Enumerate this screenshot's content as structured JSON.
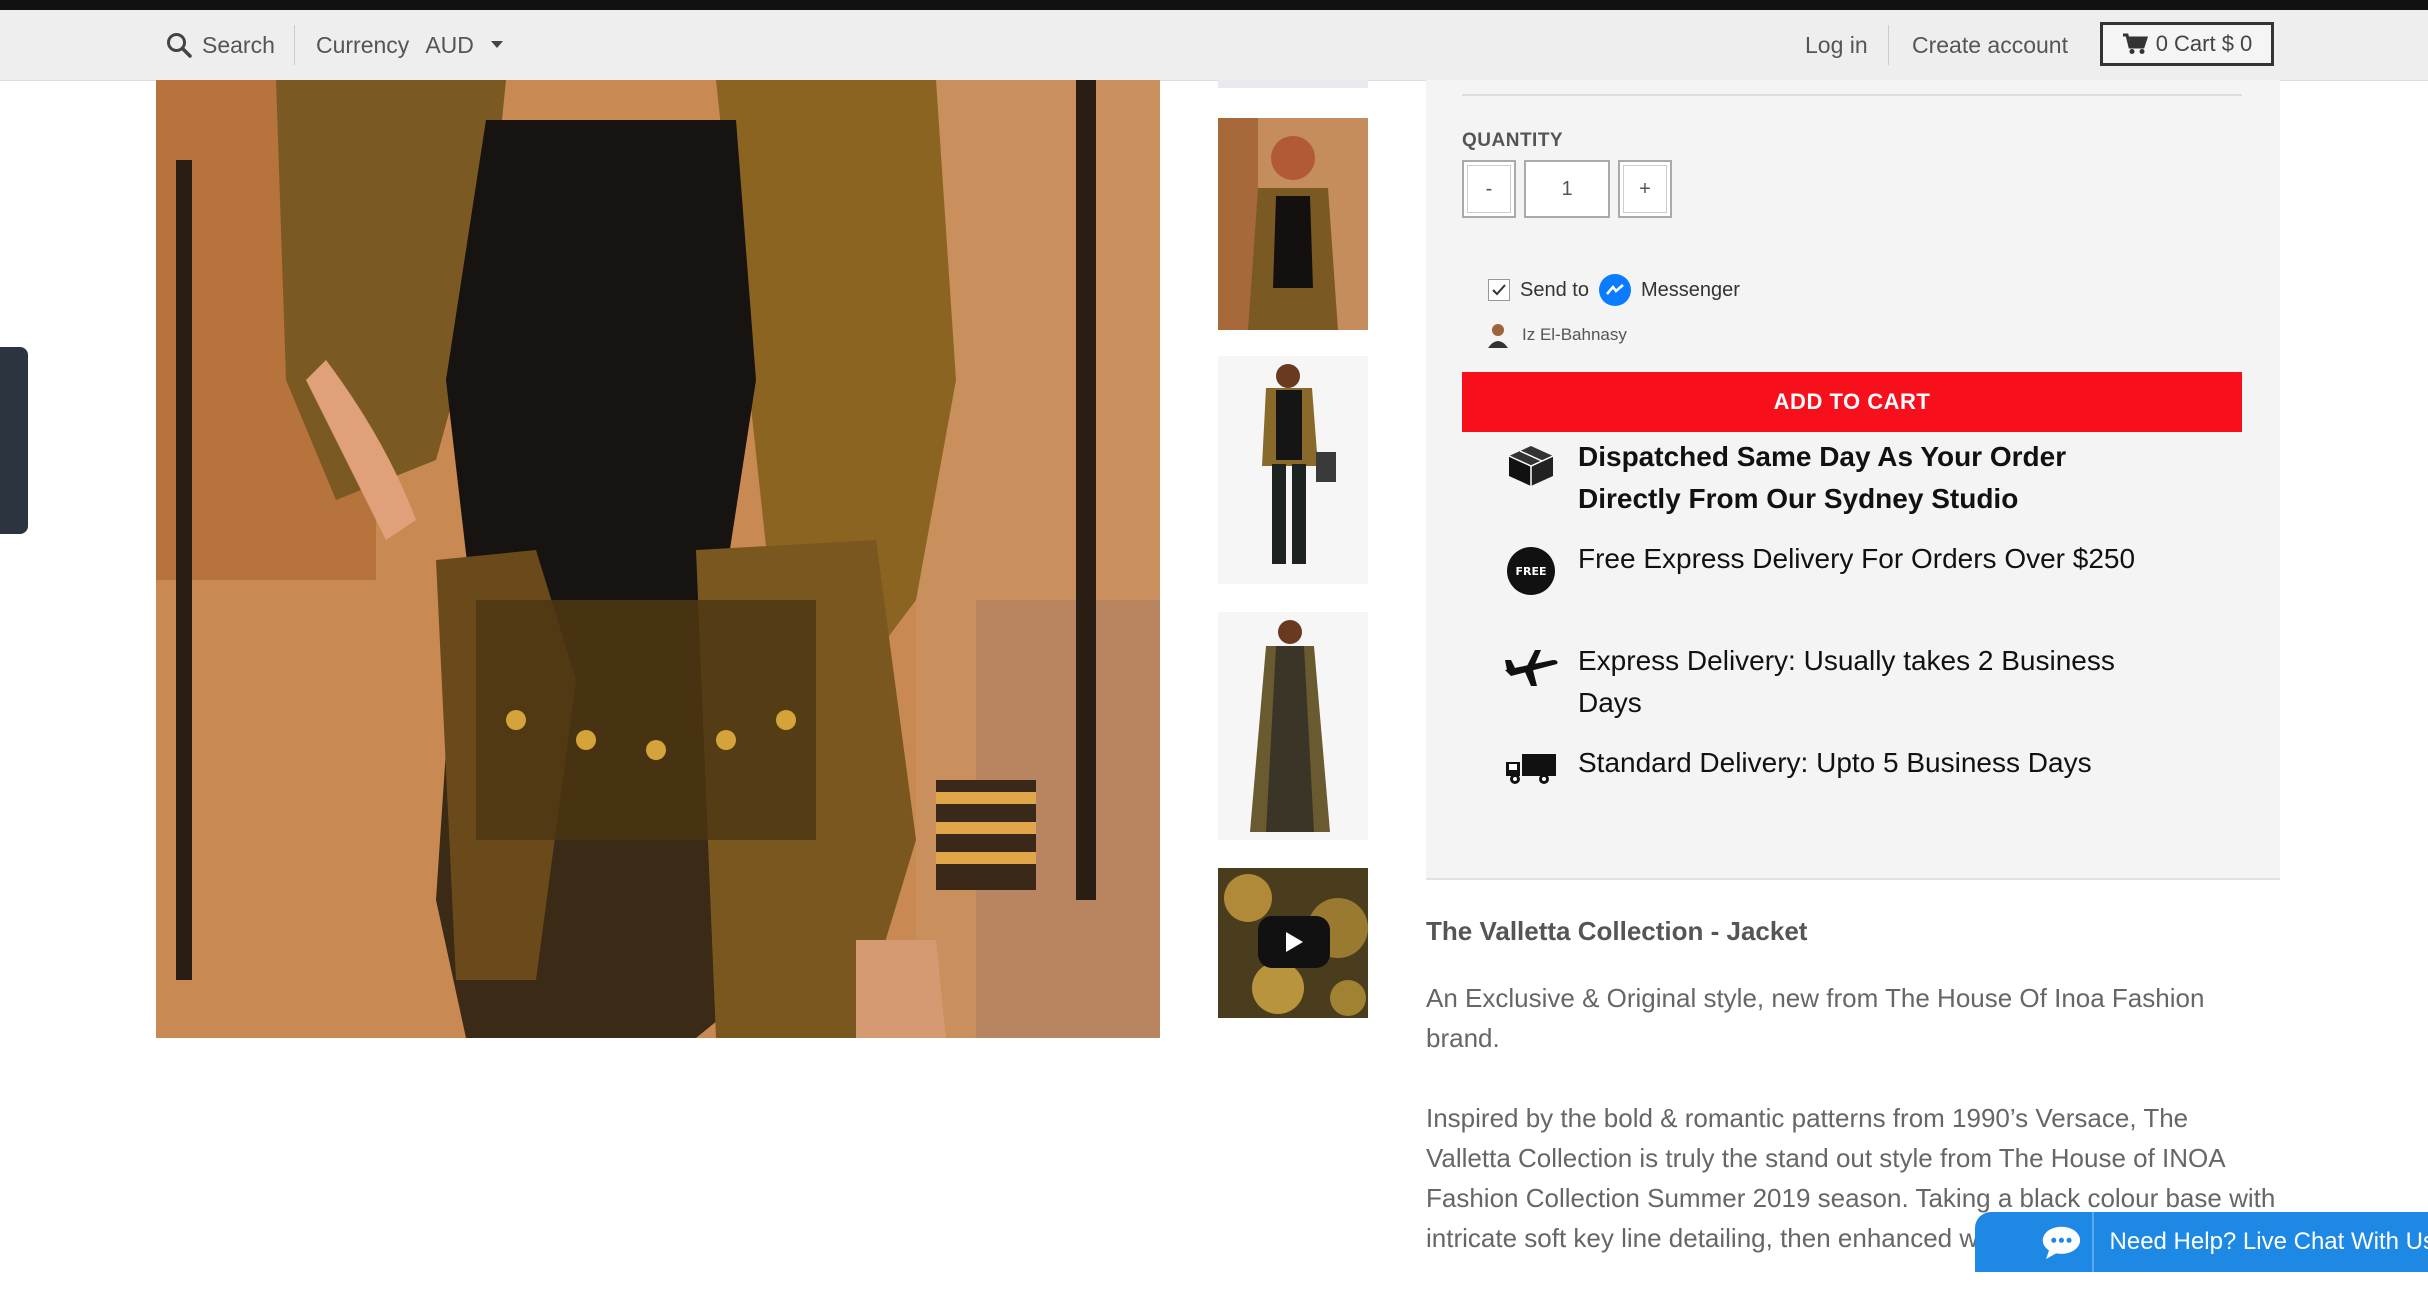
{
  "topbar": {
    "search_label": "Search",
    "currency_label": "Currency",
    "currency_value": "AUD",
    "login_label": "Log in",
    "create_account_label": "Create account",
    "cart_label": "0 Cart $ 0"
  },
  "purchase": {
    "quantity_label": "QUANTITY",
    "minus_label": "-",
    "quantity_value": "1",
    "plus_label": "+",
    "send_to_label": "Send to",
    "messenger_label": "Messenger",
    "user_name": "Iz El-Bahnasy",
    "add_to_cart_label": "ADD TO CART"
  },
  "features": [
    {
      "icon": "package-icon",
      "text": "Dispatched Same Day As Your Order Directly From Our Sydney Studio"
    },
    {
      "icon": "free-badge-icon",
      "badge": "FREE",
      "text": "Free Express Delivery For Orders Over $250"
    },
    {
      "icon": "airplane-icon",
      "text": "Express Delivery: Usually takes 2 Business Days"
    },
    {
      "icon": "truck-icon",
      "text": "Standard Delivery: Upto 5 Business Days"
    }
  ],
  "product": {
    "title": "The Valletta Collection - Jacket",
    "paragraph1": "An Exclusive & Original style, new from The House Of Inoa Fashion brand.",
    "paragraph2": "Inspired by the bold & romantic patterns from 1990’s Versace, The Valletta Collection is truly the stand out style from The House of INOA Fashion Collection Summer 2019 season. Taking a black colour base with intricate soft key line detailing, then enhanced with"
  },
  "chat": {
    "label": "Need Help? Live Chat With Us"
  },
  "colors": {
    "add_to_cart": "#f80f1c",
    "chat": "#1e88e5",
    "topbar": "#eeeeee"
  }
}
